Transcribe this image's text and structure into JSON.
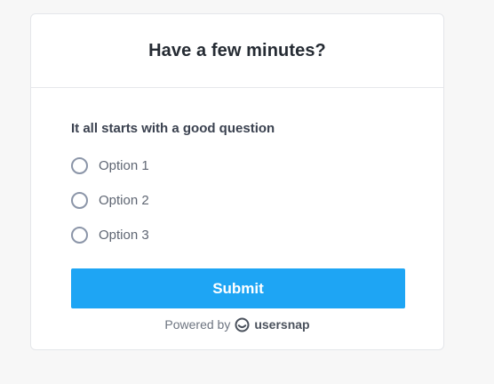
{
  "header": {
    "title": "Have a few minutes?"
  },
  "survey": {
    "question": "It all starts with a good question",
    "options": [
      {
        "label": "Option 1"
      },
      {
        "label": "Option 2"
      },
      {
        "label": "Option 3"
      }
    ],
    "submit_label": "Submit"
  },
  "footer": {
    "powered_by": "Powered by",
    "brand": "usersnap",
    "brand_icon": "usersnap-logo-icon"
  },
  "colors": {
    "accent": "#1ea5f4",
    "radio_border": "#8b95a8",
    "background": "#f7f7f7"
  }
}
